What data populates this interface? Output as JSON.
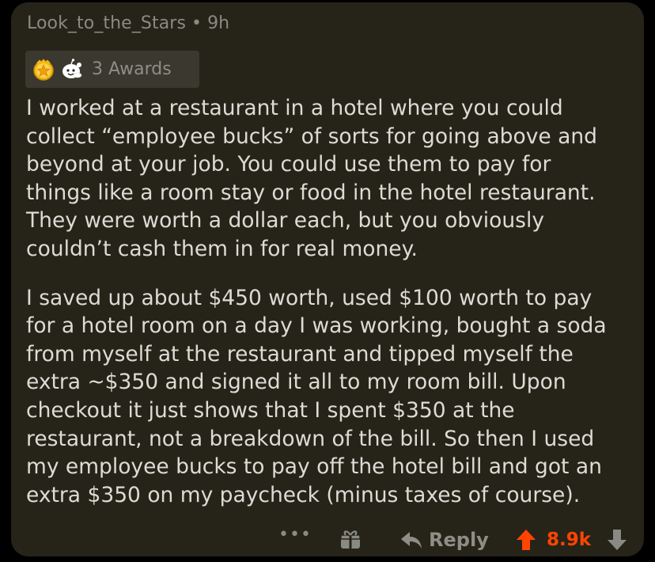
{
  "comment": {
    "author": "Look_to_the_Stars",
    "separator": "•",
    "age": "9h",
    "awards": {
      "label": "3 Awards",
      "icons": [
        "gold-star-award-icon",
        "wholesome-award-icon"
      ]
    },
    "paragraphs": [
      "I worked at a restaurant in a hotel where you could\ncollect “employee bucks” of sorts for going above and\nbeyond at your job. You could use them to pay for\nthings like a room stay or food in the hotel restaurant.\nThey were worth a dollar each, but you obviously\ncouldn’t cash them in for real money.",
      "I saved up about $450 worth, used $100 worth to pay\nfor a hotel room on a day I was working, bought a soda\nfrom myself at the restaurant and tipped myself the\nextra ~$350 and signed it all to my room bill. Upon\ncheckout it just shows that I spent $350 at the\nrestaurant, not a breakdown of the bill. So then I used\nmy employee bucks to pay off the hotel bill and got an\nextra $350 on my paycheck (minus taxes of course)."
    ]
  },
  "actions": {
    "more": "•••",
    "reply_label": "Reply",
    "score": "8.9k"
  },
  "colors": {
    "card_background": "#262419",
    "page_background": "#000000",
    "text": "#dcdcd6",
    "muted": "#8a8a84",
    "upvote_accent": "#ff4500"
  }
}
